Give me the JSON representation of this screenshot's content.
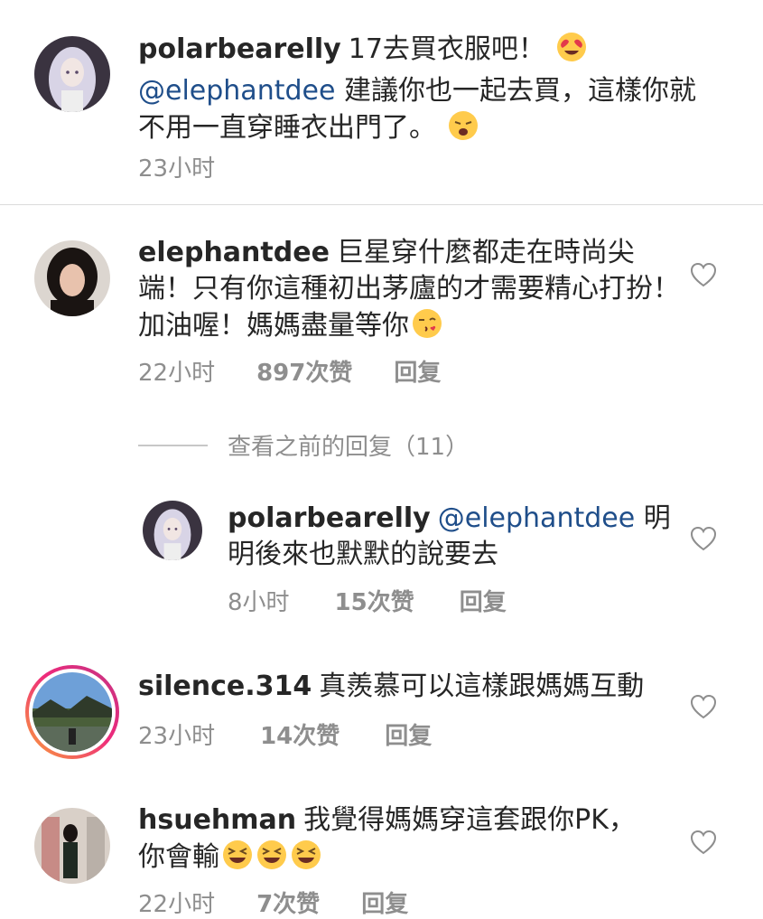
{
  "comments": [
    {
      "username": "polarbearelly",
      "text1": "17去買衣服吧！",
      "emoji1": "heart-eyes",
      "mention": "@elephantdee",
      "text2": " 建議你也一起去買，這樣你就不用一直穿睡衣出門了。",
      "emoji2": "tired-face",
      "time": "23小时"
    },
    {
      "username": "elephantdee",
      "text": "巨星穿什麼都走在時尚尖端！只有你這種初出茅廬的才需要精心打扮！加油喔！媽媽盡量等你",
      "emoji": "kissing-heart",
      "time": "22小时",
      "likes": "897次赞",
      "reply": "回复"
    }
  ],
  "view_previous": "查看之前的回复（11）",
  "reply_thread": {
    "username": "polarbearelly",
    "mention": "@elephantdee",
    "text": " 明明後來也默默的說要去",
    "time": "8小时",
    "likes": "15次赞",
    "reply": "回复"
  },
  "comments_more": [
    {
      "username": "silence.314",
      "text": "真羨慕可以這樣跟媽媽互動",
      "time": "23小时",
      "likes": "14次赞",
      "reply": "回复"
    },
    {
      "username": "hsuehman",
      "text": "我覺得媽媽穿這套跟你PK，你會輸",
      "emoji": "laughing",
      "time": "22小时",
      "likes": "7次赞",
      "reply": "回复"
    }
  ],
  "icons": {
    "like": "heart-outline-icon"
  },
  "colors": {
    "mention": "#1f4e8a",
    "meta": "#8e8e8e",
    "divider": "#dbdbdb"
  }
}
